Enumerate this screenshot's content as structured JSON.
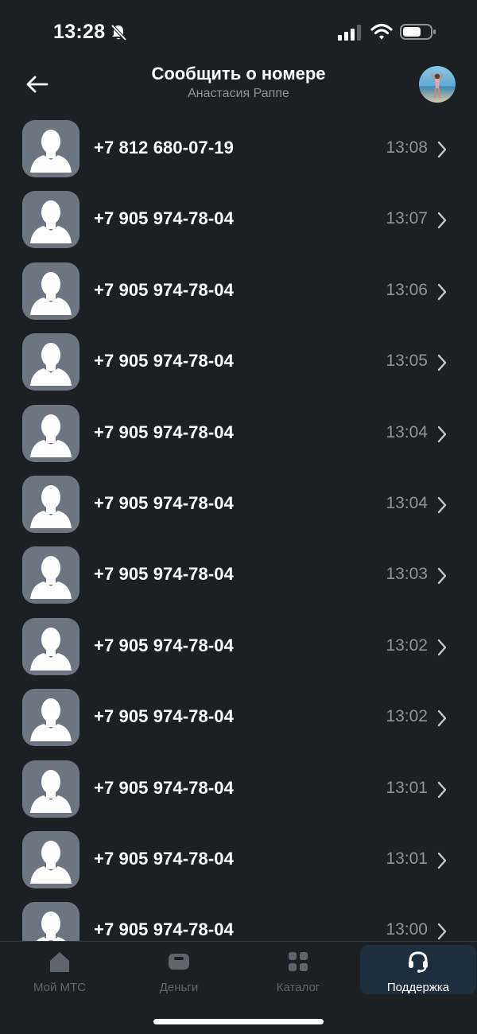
{
  "status_bar": {
    "time": "13:28"
  },
  "header": {
    "title": "Сообщить о номере",
    "subtitle": "Анастасия Раппе"
  },
  "calls": [
    {
      "number": "+7 812 680-07-19",
      "time": "13:08"
    },
    {
      "number": "+7 905 974-78-04",
      "time": "13:07"
    },
    {
      "number": "+7 905 974-78-04",
      "time": "13:06"
    },
    {
      "number": "+7 905 974-78-04",
      "time": "13:05"
    },
    {
      "number": "+7 905 974-78-04",
      "time": "13:04"
    },
    {
      "number": "+7 905 974-78-04",
      "time": "13:04"
    },
    {
      "number": "+7 905 974-78-04",
      "time": "13:03"
    },
    {
      "number": "+7 905 974-78-04",
      "time": "13:02"
    },
    {
      "number": "+7 905 974-78-04",
      "time": "13:02"
    },
    {
      "number": "+7 905 974-78-04",
      "time": "13:01"
    },
    {
      "number": "+7 905 974-78-04",
      "time": "13:01"
    },
    {
      "number": "+7 905 974-78-04",
      "time": "13:00"
    }
  ],
  "tabs": [
    {
      "label": "Мой МТС",
      "icon": "home-icon"
    },
    {
      "label": "Деньги",
      "icon": "wallet-icon"
    },
    {
      "label": "Каталог",
      "icon": "grid-icon"
    },
    {
      "label": "Поддержка",
      "icon": "headset-icon",
      "active": true
    }
  ],
  "colors": {
    "background": "#1d2023",
    "placeholder_avatar": "#6d7680",
    "secondary_text": "#8d939a",
    "active_tab": "#1f2e3d"
  }
}
